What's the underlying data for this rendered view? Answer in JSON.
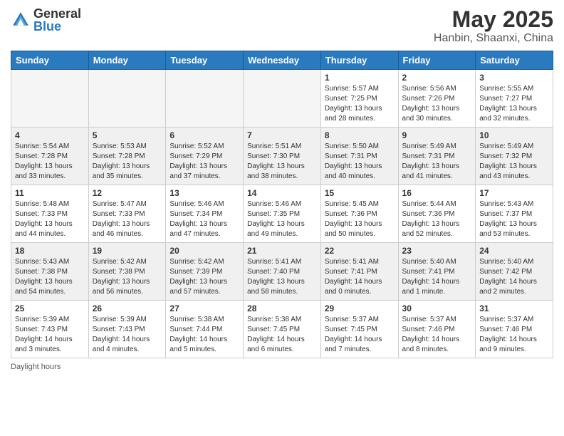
{
  "logo": {
    "general": "General",
    "blue": "Blue"
  },
  "title": "May 2025",
  "subtitle": "Hanbin, Shaanxi, China",
  "days_of_week": [
    "Sunday",
    "Monday",
    "Tuesday",
    "Wednesday",
    "Thursday",
    "Friday",
    "Saturday"
  ],
  "footer": "Daylight hours",
  "weeks": [
    [
      {
        "day": "",
        "info": ""
      },
      {
        "day": "",
        "info": ""
      },
      {
        "day": "",
        "info": ""
      },
      {
        "day": "",
        "info": ""
      },
      {
        "day": "1",
        "info": "Sunrise: 5:57 AM\nSunset: 7:25 PM\nDaylight: 13 hours\nand 28 minutes."
      },
      {
        "day": "2",
        "info": "Sunrise: 5:56 AM\nSunset: 7:26 PM\nDaylight: 13 hours\nand 30 minutes."
      },
      {
        "day": "3",
        "info": "Sunrise: 5:55 AM\nSunset: 7:27 PM\nDaylight: 13 hours\nand 32 minutes."
      }
    ],
    [
      {
        "day": "4",
        "info": "Sunrise: 5:54 AM\nSunset: 7:28 PM\nDaylight: 13 hours\nand 33 minutes."
      },
      {
        "day": "5",
        "info": "Sunrise: 5:53 AM\nSunset: 7:28 PM\nDaylight: 13 hours\nand 35 minutes."
      },
      {
        "day": "6",
        "info": "Sunrise: 5:52 AM\nSunset: 7:29 PM\nDaylight: 13 hours\nand 37 minutes."
      },
      {
        "day": "7",
        "info": "Sunrise: 5:51 AM\nSunset: 7:30 PM\nDaylight: 13 hours\nand 38 minutes."
      },
      {
        "day": "8",
        "info": "Sunrise: 5:50 AM\nSunset: 7:31 PM\nDaylight: 13 hours\nand 40 minutes."
      },
      {
        "day": "9",
        "info": "Sunrise: 5:49 AM\nSunset: 7:31 PM\nDaylight: 13 hours\nand 41 minutes."
      },
      {
        "day": "10",
        "info": "Sunrise: 5:49 AM\nSunset: 7:32 PM\nDaylight: 13 hours\nand 43 minutes."
      }
    ],
    [
      {
        "day": "11",
        "info": "Sunrise: 5:48 AM\nSunset: 7:33 PM\nDaylight: 13 hours\nand 44 minutes."
      },
      {
        "day": "12",
        "info": "Sunrise: 5:47 AM\nSunset: 7:33 PM\nDaylight: 13 hours\nand 46 minutes."
      },
      {
        "day": "13",
        "info": "Sunrise: 5:46 AM\nSunset: 7:34 PM\nDaylight: 13 hours\nand 47 minutes."
      },
      {
        "day": "14",
        "info": "Sunrise: 5:46 AM\nSunset: 7:35 PM\nDaylight: 13 hours\nand 49 minutes."
      },
      {
        "day": "15",
        "info": "Sunrise: 5:45 AM\nSunset: 7:36 PM\nDaylight: 13 hours\nand 50 minutes."
      },
      {
        "day": "16",
        "info": "Sunrise: 5:44 AM\nSunset: 7:36 PM\nDaylight: 13 hours\nand 52 minutes."
      },
      {
        "day": "17",
        "info": "Sunrise: 5:43 AM\nSunset: 7:37 PM\nDaylight: 13 hours\nand 53 minutes."
      }
    ],
    [
      {
        "day": "18",
        "info": "Sunrise: 5:43 AM\nSunset: 7:38 PM\nDaylight: 13 hours\nand 54 minutes."
      },
      {
        "day": "19",
        "info": "Sunrise: 5:42 AM\nSunset: 7:38 PM\nDaylight: 13 hours\nand 56 minutes."
      },
      {
        "day": "20",
        "info": "Sunrise: 5:42 AM\nSunset: 7:39 PM\nDaylight: 13 hours\nand 57 minutes."
      },
      {
        "day": "21",
        "info": "Sunrise: 5:41 AM\nSunset: 7:40 PM\nDaylight: 13 hours\nand 58 minutes."
      },
      {
        "day": "22",
        "info": "Sunrise: 5:41 AM\nSunset: 7:41 PM\nDaylight: 14 hours\nand 0 minutes."
      },
      {
        "day": "23",
        "info": "Sunrise: 5:40 AM\nSunset: 7:41 PM\nDaylight: 14 hours\nand 1 minute."
      },
      {
        "day": "24",
        "info": "Sunrise: 5:40 AM\nSunset: 7:42 PM\nDaylight: 14 hours\nand 2 minutes."
      }
    ],
    [
      {
        "day": "25",
        "info": "Sunrise: 5:39 AM\nSunset: 7:43 PM\nDaylight: 14 hours\nand 3 minutes."
      },
      {
        "day": "26",
        "info": "Sunrise: 5:39 AM\nSunset: 7:43 PM\nDaylight: 14 hours\nand 4 minutes."
      },
      {
        "day": "27",
        "info": "Sunrise: 5:38 AM\nSunset: 7:44 PM\nDaylight: 14 hours\nand 5 minutes."
      },
      {
        "day": "28",
        "info": "Sunrise: 5:38 AM\nSunset: 7:45 PM\nDaylight: 14 hours\nand 6 minutes."
      },
      {
        "day": "29",
        "info": "Sunrise: 5:37 AM\nSunset: 7:45 PM\nDaylight: 14 hours\nand 7 minutes."
      },
      {
        "day": "30",
        "info": "Sunrise: 5:37 AM\nSunset: 7:46 PM\nDaylight: 14 hours\nand 8 minutes."
      },
      {
        "day": "31",
        "info": "Sunrise: 5:37 AM\nSunset: 7:46 PM\nDaylight: 14 hours\nand 9 minutes."
      }
    ]
  ]
}
